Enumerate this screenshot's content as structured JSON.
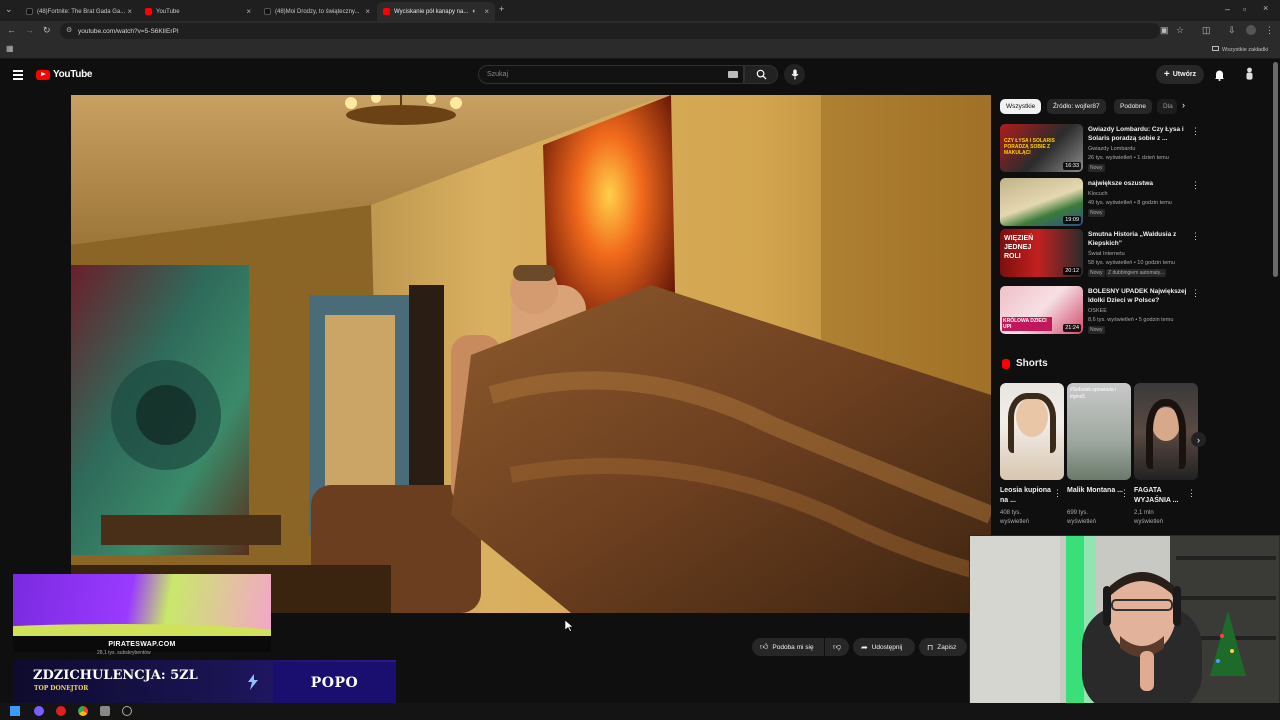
{
  "browser": {
    "tabs": [
      {
        "label": "(48)Fortnite: The Brat Gada Ga...",
        "favicon": "tiktok",
        "active": false
      },
      {
        "label": "YouTube",
        "favicon": "youtube",
        "active": false
      },
      {
        "label": "(48)Moi Drodzy, to świąteczny...",
        "favicon": "tiktok",
        "active": false
      },
      {
        "label": "Wyciskanie pół kanapy na...",
        "favicon": "youtube",
        "active": true
      }
    ],
    "new_tab": "+",
    "url": "youtube.com/watch?v=5-S6KlIErPI",
    "bookmarks_all": "Wszystkie zakładki"
  },
  "header": {
    "logo": "YouTube",
    "search_placeholder": "Szukaj",
    "create_label": "Utwórz"
  },
  "chips": [
    "Wszystkie",
    "Źródło: wojfer87",
    "Podobne",
    "Dla"
  ],
  "recommended": [
    {
      "title": "Gwiazdy Lombardu: Czy Łysa i Solaris poradzą sobie z ...",
      "channel": "Gwiazdy Lombardu",
      "stats": "26 tys. wyświetleń • 1 dzień temu",
      "badge": "Nowy",
      "duration": "16:33",
      "thumb_text": "CZY ŁYSA I SOLARIS PORADZĄ SOBIE Z MAKULĄCI"
    },
    {
      "title": "największe oszustwa",
      "channel": "Klocuch",
      "stats": "49 tys. wyświetleń • 8 godzin temu",
      "badge": "Nowy",
      "duration": "19:09",
      "thumb_text": ""
    },
    {
      "title": "Smutna Historia „Waldusia z Kiepskich”",
      "channel": "Świat Internetu",
      "stats": "58 tys. wyświetleń • 10 godzin temu",
      "badge": "Nowy",
      "badge2": "Z dubbingiem automaty...",
      "duration": "20:12",
      "thumb_text": "WIĘZIEŃ JEDNEJ ROLI"
    },
    {
      "title": "BOLESNY UPADEK Największej Idolki Dzieci w Polsce?",
      "channel": "OSKEE",
      "stats": "8,6 tys. wyświetleń • 5 godzin temu",
      "badge": "Nowy",
      "duration": "21:24",
      "thumb_text": "KRÓLOWA DZIECI UPI"
    }
  ],
  "shorts": {
    "heading": "Shorts",
    "items": [
      {
        "title": "Leosia kupiona na ...",
        "views": "408 tys. wyświetleń"
      },
      {
        "title": "Malik Montana ...",
        "views": "699 tys. wyświetleń",
        "thumb_text": "#Sebulek.opowiada i #gms5"
      },
      {
        "title": "FAGATA WYJAŚNIA ...",
        "views": "2,1 mln wyświetleń"
      }
    ]
  },
  "actions": {
    "like": "Podoba mi się",
    "share": "Udostępnij",
    "save": "Zapisz"
  },
  "channel_subs": "28,1 tys. subskrybentów",
  "overlays": {
    "ad_domain": "PIRATESWAP.COM",
    "donation_title": "ZDZICHULENCJA: 5ZL",
    "donation_sub": "TOP DONEJTOR",
    "donation_name": "POPO"
  },
  "colors": {
    "yt_red": "#ff0000",
    "bg": "#0f0f0f",
    "chip": "#272727"
  }
}
